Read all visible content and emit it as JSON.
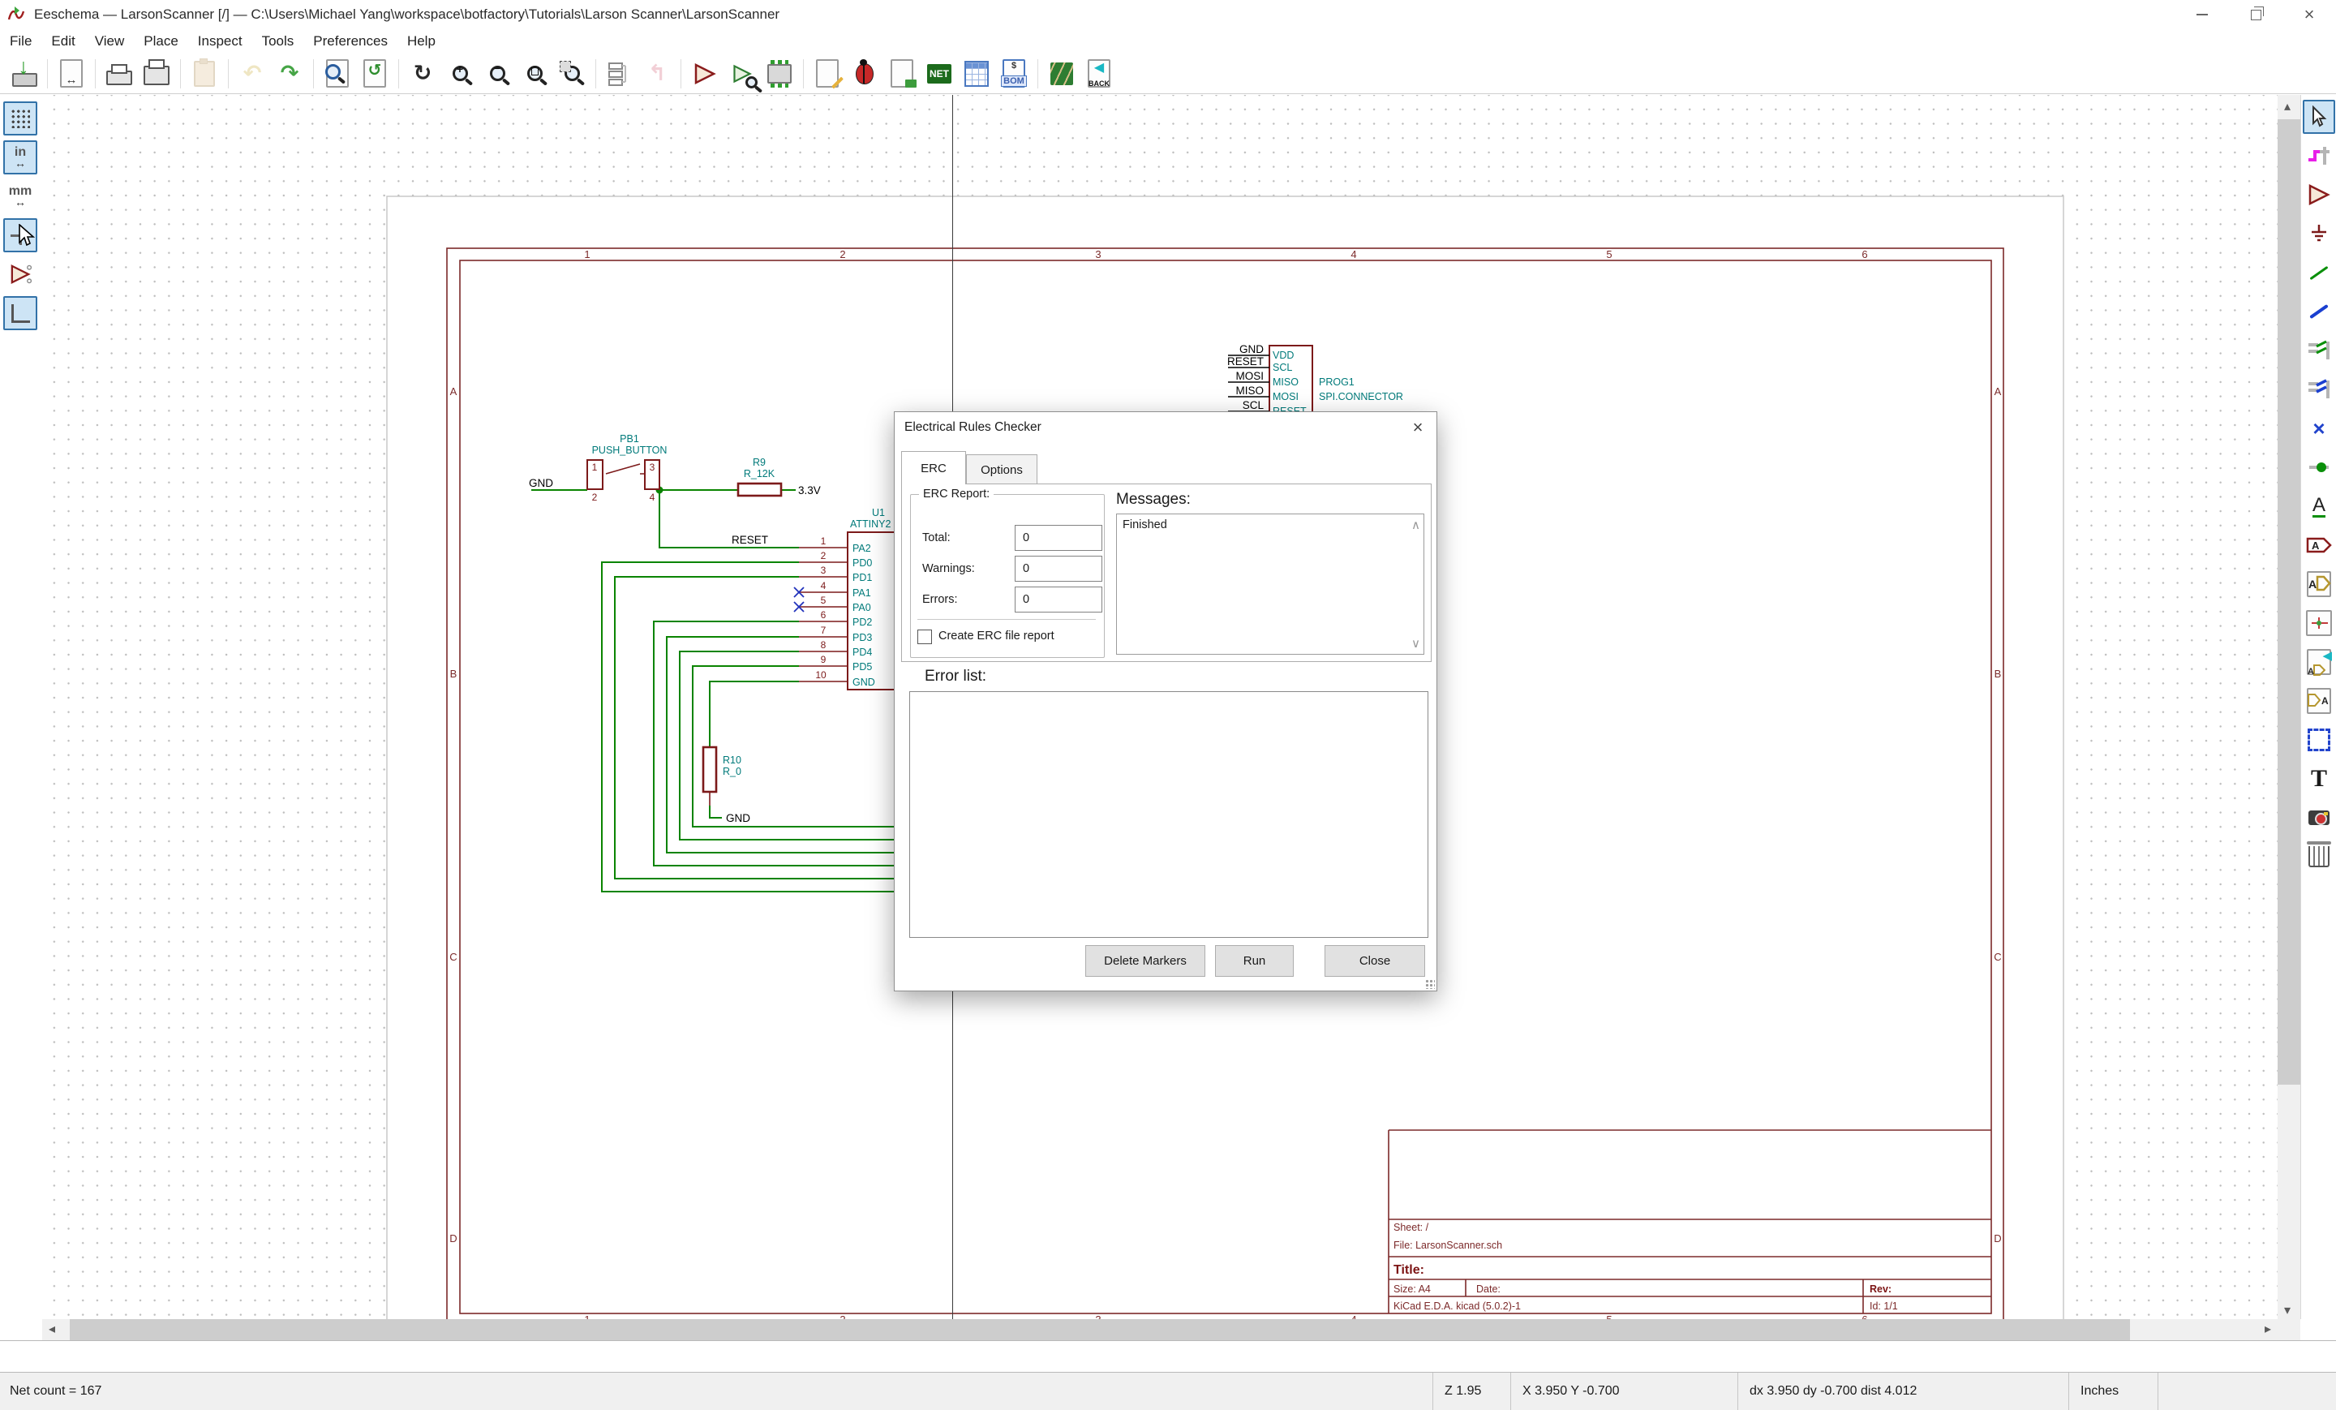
{
  "window": {
    "title": "Eeschema — LarsonScanner [/] — C:\\Users\\Michael Yang\\workspace\\botfactory\\Tutorials\\Larson Scanner\\LarsonScanner"
  },
  "menu": {
    "items": [
      "File",
      "Edit",
      "View",
      "Place",
      "Inspect",
      "Tools",
      "Preferences",
      "Help"
    ]
  },
  "toolbar": {
    "netlist": "NET",
    "bom": "BOM",
    "bom_currency": "$",
    "back": "BACK"
  },
  "left_toolbar": {
    "inches": "in",
    "mm": "mm"
  },
  "right_toolbar": {
    "net_label": "A",
    "global_label": "A",
    "hier_label": "A",
    "sheet_pin": "A",
    "text_tool": "T"
  },
  "statusbar": {
    "net_count": "Net count = 167",
    "zoom": "Z 1.95",
    "cursor_pos": "X 3.950  Y -0.700",
    "delta": "dx 3.950  dy -0.700  dist 4.012",
    "units": "Inches"
  },
  "dialog": {
    "title": "Electrical Rules Checker",
    "tab_erc": "ERC",
    "tab_options": "Options",
    "erc_report": "ERC Report:",
    "total": "Total:",
    "total_value": "0",
    "warnings": "Warnings:",
    "warnings_value": "0",
    "errors": "Errors:",
    "errors_value": "0",
    "create_report": "Create ERC file report",
    "messages": "Messages:",
    "message_finished": "Finished",
    "error_list": "Error list:",
    "btn_delete": "Delete Markers",
    "btn_run": "Run",
    "btn_close": "Close"
  },
  "schematic": {
    "border": {
      "cols": [
        "1",
        "2",
        "3",
        "4",
        "5",
        "6"
      ],
      "rows": [
        "A",
        "B",
        "C",
        "D"
      ]
    },
    "title_block": {
      "sheet": "Sheet: /",
      "file": "File: LarsonScanner.sch",
      "title": "Title:",
      "size": "Size: A4",
      "date": "Date:",
      "rev": "Rev:",
      "kicad": "KiCad E.D.A.  kicad (5.0.2)-1",
      "id": "Id: 1/1"
    },
    "mcu": {
      "ref": "U1",
      "value": "ATTINY2",
      "pins": [
        {
          "num": "1",
          "name": "PA2"
        },
        {
          "num": "2",
          "name": "PD0"
        },
        {
          "num": "3",
          "name": "PD1"
        },
        {
          "num": "4",
          "name": "PA1"
        },
        {
          "num": "5",
          "name": "PA0"
        },
        {
          "num": "6",
          "name": "PD2"
        },
        {
          "num": "7",
          "name": "PD3"
        },
        {
          "num": "8",
          "name": "PD4"
        },
        {
          "num": "9",
          "name": "PD5"
        },
        {
          "num": "10",
          "name": "GND"
        }
      ]
    },
    "pb": {
      "ref": "PB1",
      "value": "PUSH_BUTTON",
      "p1": "1",
      "p2": "2",
      "p3": "3",
      "p4": "4"
    },
    "labels": {
      "gnd_left": "GND",
      "reset": "RESET",
      "v33": "3.3V",
      "r10_gnd": "GND"
    },
    "r9": {
      "ref": "R9",
      "value": "R_12K"
    },
    "r10": {
      "ref": "R10",
      "value": "R_0"
    },
    "prog": {
      "ref": "PROG1",
      "value": "SPI.CONNECTOR",
      "left": [
        "GND",
        "RESET",
        "MOSI",
        "MISO",
        "SCL"
      ],
      "names": [
        "VDD",
        "SCL",
        "MISO",
        "MOSI",
        "RESET"
      ]
    }
  }
}
